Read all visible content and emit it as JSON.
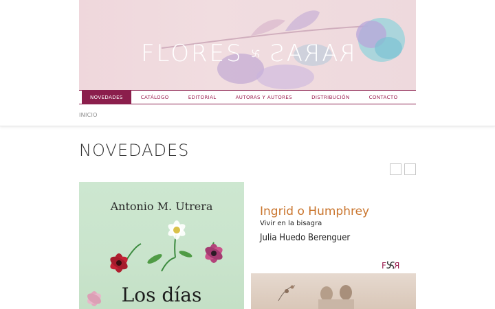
{
  "header": {
    "logo_word_1": "FLORES",
    "logo_word_2": "RARAS",
    "banner_color": "#efd7dc",
    "logo_icon": "pinwheel-icon"
  },
  "nav": {
    "items": [
      {
        "label": "NOVEDADES",
        "active": true
      },
      {
        "label": "CATÁLOGO",
        "active": false
      },
      {
        "label": "EDITORIAL",
        "active": false
      },
      {
        "label": "AUTORAS Y AUTORES",
        "active": false
      },
      {
        "label": "DISTRIBUCIÓN",
        "active": false
      },
      {
        "label": "CONTACTO",
        "active": false
      }
    ],
    "accent_color": "#8b1e4c"
  },
  "breadcrumb": {
    "home": "INICIO"
  },
  "main": {
    "title": "NOVEDADES",
    "carousel": {
      "prev_icon": "prev-arrow-icon",
      "next_icon": "next-arrow-icon"
    },
    "books": [
      {
        "author": "Antonio M. Utrera",
        "title": "Los días",
        "cover_color": "#cde7d0"
      },
      {
        "title": "Ingrid o Humphrey",
        "subtitle": "Vivir en la bisagra",
        "author": "Julia Huedo Berenguer",
        "publisher_mark": "FR",
        "title_color": "#c9742c"
      }
    ]
  }
}
